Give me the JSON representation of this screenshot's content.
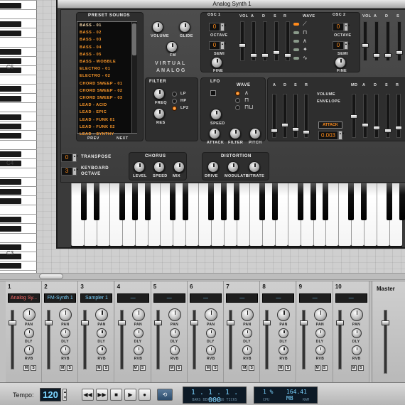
{
  "window": {
    "title": "Analog Synth 1"
  },
  "piano_roll": {
    "octave_labels": [
      "C5",
      "C4",
      "C3"
    ]
  },
  "synth": {
    "preset_title": "PRESET SOUNDS",
    "presets": [
      "BASS - 01",
      "BASS - 02",
      "BASS - 03",
      "BASS - 04",
      "BASS - 05",
      "BASS - WOBBLE",
      "ELECTRO - 01",
      "ELECTRO - 02",
      "CHORD SWEEP - 01",
      "CHORD SWEEP - 02",
      "CHORD SWEEP - 03",
      "LEAD - ACID",
      "LEAD - EPIC",
      "LEAD - FUNK 01",
      "LEAD - FUNK 02",
      "LEAD - SYNTHY"
    ],
    "prev_label": "PREV",
    "next_label": "NEXT",
    "volume_label": "VOLUME",
    "glide_label": "GLIDE",
    "fm_label": "FM",
    "logo_line1": "VIRTUAL",
    "logo_line2": "ANALOG",
    "osc1": {
      "title": "OSC 1",
      "octave_value": "0",
      "octave_label": "OCTAVE",
      "semi_value": "0",
      "semi_label": "SEMI",
      "fine_label": "FINE"
    },
    "osc2": {
      "title": "OSC 2",
      "octave_value": "0",
      "octave_label": "OCTAVE",
      "semi_value": "0",
      "semi_label": "SEMI",
      "fine_label": "FINE"
    },
    "env_labels": {
      "vol": "VOL",
      "a": "A",
      "d": "D",
      "s": "S",
      "r": "R"
    },
    "wave_title": "WAVE",
    "filter": {
      "title": "FILTER",
      "freq": "FREQ",
      "res": "RES",
      "lp": "LP",
      "hp": "HP",
      "lp2": "LP2"
    },
    "lfo": {
      "title": "LFO",
      "wave": "WAVE",
      "speed": "SPEED",
      "attack": "ATTACK",
      "filter": "FILTER",
      "pitch": "PITCH"
    },
    "envelope": {
      "vol_label": "VOLUME",
      "env_label": "ENVELOPE",
      "mod_labels": [
        "MD",
        "A",
        "D",
        "S",
        "R"
      ],
      "attack_btn": "ATTACK",
      "attack_value": "0.003",
      "left_labels": [
        "A",
        "D",
        "S",
        "R"
      ]
    },
    "transpose": {
      "value": "0",
      "label": "TRANSPOSE"
    },
    "keyboard_octave": {
      "value": "3",
      "label1": "KEYBOARD",
      "label2": "OCTAVE"
    },
    "chorus": {
      "title": "CHORUS",
      "level": "LEVEL",
      "speed": "SPEED",
      "mix": "MIX"
    },
    "distortion": {
      "title": "DISTORTION",
      "drive": "DRIVE",
      "modulate": "MODULATE",
      "bitrate": "BITRATE"
    }
  },
  "mixer": {
    "channels": [
      {
        "num": "1",
        "name": "Analog Sy..."
      },
      {
        "num": "2",
        "name": "FM-Synth 1"
      },
      {
        "num": "3",
        "name": "Sampler 1"
      },
      {
        "num": "4",
        "name": "—"
      },
      {
        "num": "5",
        "name": "—"
      },
      {
        "num": "6",
        "name": "—"
      },
      {
        "num": "7",
        "name": "—"
      },
      {
        "num": "8",
        "name": "—"
      },
      {
        "num": "9",
        "name": "—"
      },
      {
        "num": "10",
        "name": "—"
      }
    ],
    "master_label": "Master",
    "knob_labels": {
      "pan": "PAN",
      "dly": "DLY",
      "rvb": "RVB"
    },
    "mute": "M",
    "solo": "S"
  },
  "transport": {
    "tempo_label": "Tempo:",
    "tempo_value": "120",
    "position": "1 . 1 . 1 . 000",
    "position_caption": "BARS BEATS 1/16 TICKS",
    "cpu_value": "1 %",
    "cpu_label": "CPU",
    "ram_value": "164.41 MB",
    "ram_label": "RAM"
  }
}
